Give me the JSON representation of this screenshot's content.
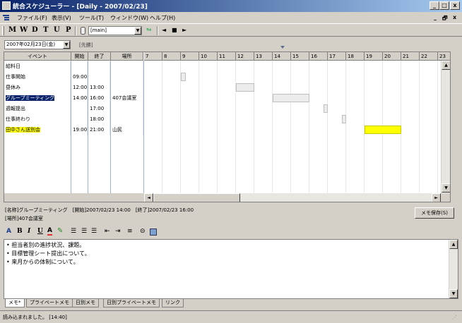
{
  "window": {
    "title": "統合スケジューラー - [Daily - 2007/02/23]",
    "controls": [
      "_",
      "□",
      "x"
    ]
  },
  "menu": {
    "items": [
      "ファイル(F)",
      "表示(V)",
      "ツール(T)",
      "ウィンドウ(W)",
      "ヘルプ(H)"
    ],
    "mdi_controls": [
      "_",
      "🗗",
      "x"
    ]
  },
  "toolbar": {
    "views": [
      "M",
      "W",
      "D",
      "T",
      "U",
      "P"
    ],
    "db_value": "[main]",
    "nav": [
      "◄",
      "■",
      "►"
    ]
  },
  "date": {
    "selected": "2007年02月23日(金)",
    "rokuyo": "[先勝]"
  },
  "grid": {
    "columns": [
      "イベント",
      "開始",
      "終了",
      "場所"
    ],
    "hours": [
      "7",
      "8",
      "9",
      "10",
      "11",
      "12",
      "13",
      "14",
      "15",
      "16",
      "17",
      "18",
      "19",
      "20",
      "21",
      "22",
      "23"
    ],
    "rows": [
      {
        "event": "給料日",
        "start": "",
        "end": "",
        "place": "",
        "highlight": ""
      },
      {
        "event": "仕事開始",
        "start": "09:00",
        "end": "",
        "place": "",
        "highlight": ""
      },
      {
        "event": "昼休み",
        "start": "12:00",
        "end": "13:00",
        "place": "",
        "highlight": ""
      },
      {
        "event": "グループミーティング",
        "start": "14:00",
        "end": "16:00",
        "place": "407会議室",
        "highlight": "selected"
      },
      {
        "event": "週報提出",
        "start": "",
        "end": "17:00",
        "place": "",
        "highlight": ""
      },
      {
        "event": "仕事終わり",
        "start": "",
        "end": "18:00",
        "place": "",
        "highlight": ""
      },
      {
        "event": "田中さん送別会",
        "start": "19:00",
        "end": "21:00",
        "place": "山民",
        "highlight": "yellow"
      }
    ]
  },
  "detail": {
    "line1": "[名称]グループミーティング　[開始]2007/02/23 14:00　[終了]2007/02/23 16:00",
    "line2": "[場所]407会議室",
    "save_label": "メモ保存(S)"
  },
  "format_bar": {
    "bold": "B",
    "italic": "I",
    "underline": "U",
    "color": "A",
    "font_letter": "A"
  },
  "memo": {
    "lines": [
      "• 担当者別の進捗状況、課題。",
      "• 目標管理シート提出について。",
      "• 来月からの体制について。"
    ]
  },
  "tabs": [
    "メモ*",
    "プライベートメモ",
    "日別メモ",
    "日別プライベートメモ",
    "リンク"
  ],
  "status": {
    "text": "読み込まれました。 [14:40]"
  },
  "colors": {
    "selected_bg": "#0a246a",
    "yellow": "#ffff00",
    "title_start": "#0a246a",
    "title_end": "#a6caf0"
  }
}
